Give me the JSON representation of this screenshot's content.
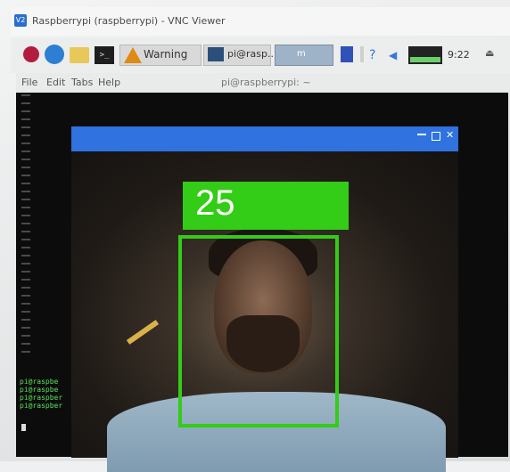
{
  "vnc": {
    "title": "Raspberrypi (raspberrypi) - VNC Viewer",
    "app_icon": "V2"
  },
  "taskbar": {
    "warning_label": "Warning",
    "terminal_label": "pi@rasp...",
    "thumb_label": "m",
    "clock": "9:22",
    "icons": [
      "raspberry-pi-icon",
      "web-browser-icon",
      "file-manager-icon",
      "terminal-icon",
      "bluetooth-icon",
      "wifi-icon",
      "volume-icon",
      "cpu-monitor-icon",
      "eject-icon"
    ]
  },
  "terminal": {
    "title": "pi@raspberrypi: ~",
    "menu": [
      "File",
      "Edit",
      "Tabs",
      "Help"
    ],
    "prompt_lines": [
      "pi@raspbe",
      "pi@raspbe",
      "pi@raspber",
      "pi@raspber"
    ]
  },
  "detection": {
    "age": "25",
    "box_color": "#33cc17"
  },
  "colors": {
    "cam_titlebar": "#2f72e0",
    "terminal_bg": "#0c0c0c"
  }
}
